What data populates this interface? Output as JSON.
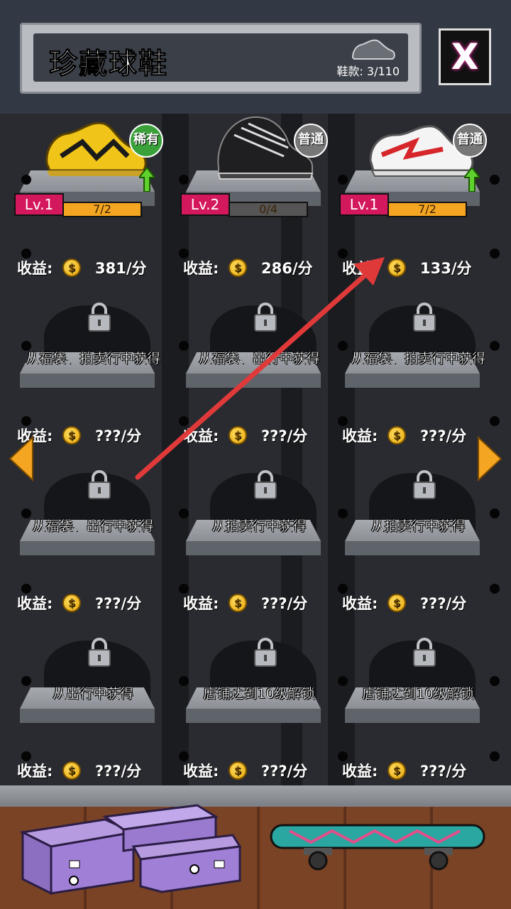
{
  "header": {
    "title": "珍藏球鞋",
    "shoe_count": "鞋款: 3/110",
    "close_label": "X"
  },
  "income_label": "收益:",
  "coin_glyph": "$",
  "owned": [
    {
      "level": "Lv.1",
      "progress": "7/2",
      "progress_fraction": 1.0,
      "rarity": "稀有",
      "rarity_color": "#3aa13a",
      "income": "381/分",
      "upgradable": true
    },
    {
      "level": "Lv.2",
      "progress": "0/4",
      "progress_fraction": 0.0,
      "rarity": "普通",
      "rarity_color": "#777777",
      "income": "286/分",
      "upgradable": false
    },
    {
      "level": "Lv.1",
      "progress": "7/2",
      "progress_fraction": 1.0,
      "rarity": "普通",
      "rarity_color": "#777777",
      "income": "133/分",
      "upgradable": true
    }
  ],
  "locked": [
    {
      "hint": "从福袋、拍卖行中获得",
      "income": "???/分"
    },
    {
      "hint": "从福袋、出行中获得",
      "income": "???/分"
    },
    {
      "hint": "从福袋、拍卖行中获得",
      "income": "???/分"
    },
    {
      "hint": "从福袋、出行中获得",
      "income": "???/分"
    },
    {
      "hint": "从拍卖行中获得",
      "income": "???/分"
    },
    {
      "hint": "从拍卖行中获得",
      "income": "???/分"
    },
    {
      "hint": "从出行中获得",
      "income": "???/分"
    },
    {
      "hint": "店铺达到10级解锁",
      "income": "???/分"
    },
    {
      "hint": "店铺达到10级解锁",
      "income": "???/分"
    }
  ],
  "colors": {
    "level_badge": "#d4185e",
    "progress_fill": "#f4a522",
    "nav_arrow": "#f4a522",
    "annotation_arrow": "#e0393a"
  }
}
